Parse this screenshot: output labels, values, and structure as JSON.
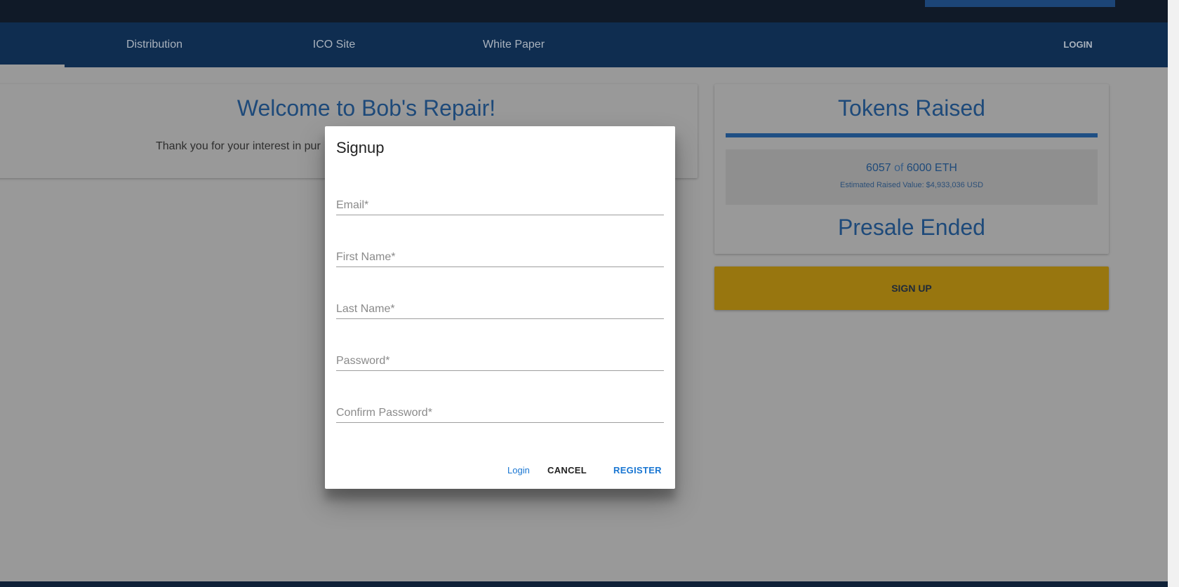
{
  "nav": {
    "items": [
      {
        "label": "Distribution"
      },
      {
        "label": "ICO Site"
      },
      {
        "label": "White Paper"
      }
    ],
    "login": "LOGIN"
  },
  "welcome": {
    "title": "Welcome to Bob's Repair!",
    "text": "Thank you for your interest in pur"
  },
  "tokens": {
    "title": "Tokens Raised",
    "raised": "6057",
    "of": "of",
    "goal": "6000 ETH",
    "progress_percent": 100,
    "estimate": "Estimated Raised Value: $4,933,036 USD",
    "status": "Presale Ended"
  },
  "signup_button": "SIGN UP",
  "dialog": {
    "title": "Signup",
    "fields": [
      {
        "placeholder": "Email*"
      },
      {
        "placeholder": "First Name*"
      },
      {
        "placeholder": "Last Name*"
      },
      {
        "placeholder": "Password*"
      },
      {
        "placeholder": "Confirm Password*"
      }
    ],
    "login": "Login",
    "cancel": "CANCEL",
    "register": "REGISTER"
  },
  "colors": {
    "nav": "#0f2d50",
    "accent": "#1976d2",
    "signup": "#98760f"
  }
}
